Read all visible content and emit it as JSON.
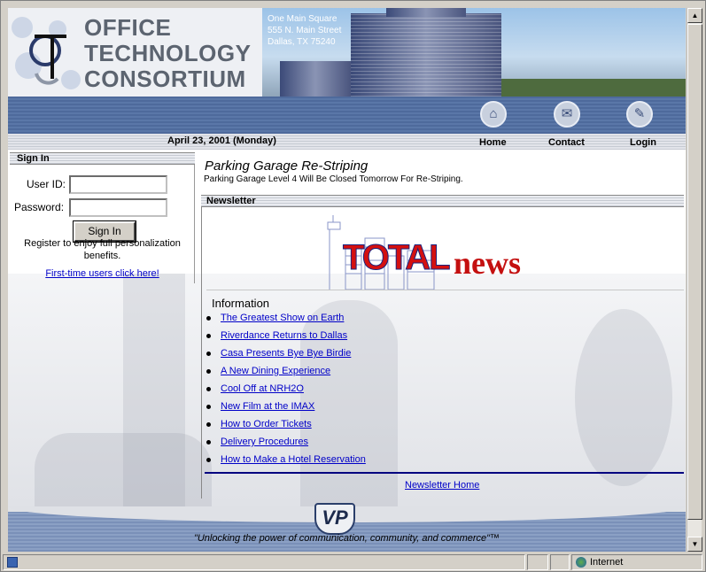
{
  "header": {
    "logo_lines": [
      "OFFICE",
      "TECHNOLOGY",
      "CONSORTIUM"
    ],
    "address": [
      "One Main Square",
      "555 N. Main Street",
      "Dallas, TX 75240"
    ]
  },
  "nav": {
    "date": "April 23, 2001 (Monday)",
    "items": [
      {
        "label": "Home",
        "icon": "house-icon"
      },
      {
        "label": "Contact",
        "icon": "envelope-icon"
      },
      {
        "label": "Login",
        "icon": "pen-icon"
      }
    ]
  },
  "signin": {
    "title": "Sign In",
    "userid_label": "User ID:",
    "userid_value": "",
    "password_label": "Password:",
    "password_value": "",
    "button": "Sign In",
    "note": "Register to enjoy full personalization benefits.",
    "first_time_link": "First-time users click here!"
  },
  "main": {
    "headline": "Parking Garage Re-Striping",
    "subline": "Parking Garage Level 4 Will Be Closed Tomorrow For Re-Striping.",
    "newsletter_title": "Newsletter",
    "banner": {
      "part1": "TOTAL",
      "part2": "news"
    },
    "info_heading": "Information",
    "links": [
      "The Greatest Show on Earth",
      "Riverdance Returns to Dallas",
      "Casa Presents Bye Bye Birdie",
      "A New Dining Experience",
      "Cool Off at NRH2O",
      "New Film at the IMAX",
      "How to Order Tickets",
      "Delivery Procedures",
      "How to Make a Hotel Reservation"
    ],
    "newsletter_home": "Newsletter Home"
  },
  "footer": {
    "emblem": "VP",
    "tagline": "\"Unlocking the power of communication, community, and commerce\"™"
  },
  "statusbar": {
    "zone": "Internet"
  },
  "colors": {
    "nav_band": "#5a77a8",
    "link": "#0000c8",
    "headline_red": "#d41010"
  }
}
